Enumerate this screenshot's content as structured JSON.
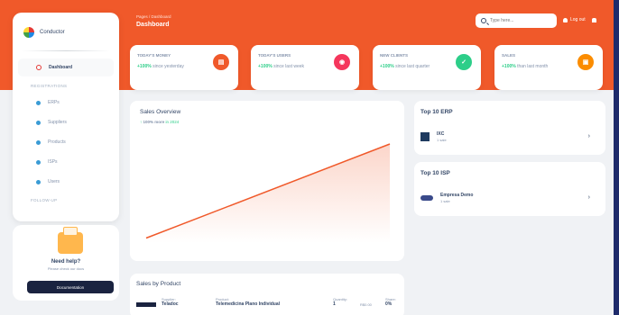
{
  "brand": {
    "name": "Conductor"
  },
  "sidebar": {
    "items": [
      {
        "label": "Dashboard",
        "active": true
      }
    ],
    "section1": "REGISTRATIONS",
    "registrations": [
      "ERPs",
      "Suppliers",
      "Products",
      "ISPs",
      "Users"
    ],
    "section2": "FOLLOW-UP"
  },
  "help": {
    "title": "Need help?",
    "subtitle": "Please check our docs",
    "button": "Documentation"
  },
  "header": {
    "breadcrumb": "Pages / Dashboard",
    "title": "Dashboard",
    "search_placeholder": "Type here...",
    "login": "Log out"
  },
  "stats": [
    {
      "title": "Today's Money",
      "pct": "+100%",
      "desc": "since yesterday",
      "icon": "money-icon",
      "color": "#f0592a"
    },
    {
      "title": "Today's Users",
      "pct": "+100%",
      "desc": "since last week",
      "icon": "users-icon",
      "color": "#f5365c"
    },
    {
      "title": "New Clients",
      "pct": "+100%",
      "desc": "since last quarter",
      "icon": "clients-icon",
      "color": "#2dce89"
    },
    {
      "title": "Sales",
      "pct": "+100%",
      "desc": "than last month",
      "icon": "cart-icon",
      "color": "#fb8c00"
    }
  ],
  "overview": {
    "title": "Sales Overview",
    "pct": "100% more",
    "suffix": "in 2024"
  },
  "chart_data": {
    "type": "area",
    "x": [
      0,
      1
    ],
    "series": [
      {
        "values": [
          5,
          100
        ]
      }
    ],
    "grid": false
  },
  "top_erp": {
    "title": "Top 10 ERP",
    "items": [
      {
        "name": "IXC",
        "sub": "1 sale"
      }
    ]
  },
  "top_isp": {
    "title": "Top 10 ISP",
    "items": [
      {
        "name": "Empresa Demo",
        "sub": "1 sale"
      }
    ]
  },
  "products": {
    "title": "Sales by Product",
    "row": {
      "supplier_label": "Supplier:",
      "supplier": "Teladoc",
      "product_label": "Product:",
      "product": "Telemedicina Plano Individual",
      "qty_label": "Quantity:",
      "qty": "1",
      "price": "R$0.00",
      "share_label": "Share:",
      "share": "0%"
    }
  },
  "colors": {
    "accent": "#f0592a",
    "navy": "#1a2340"
  }
}
